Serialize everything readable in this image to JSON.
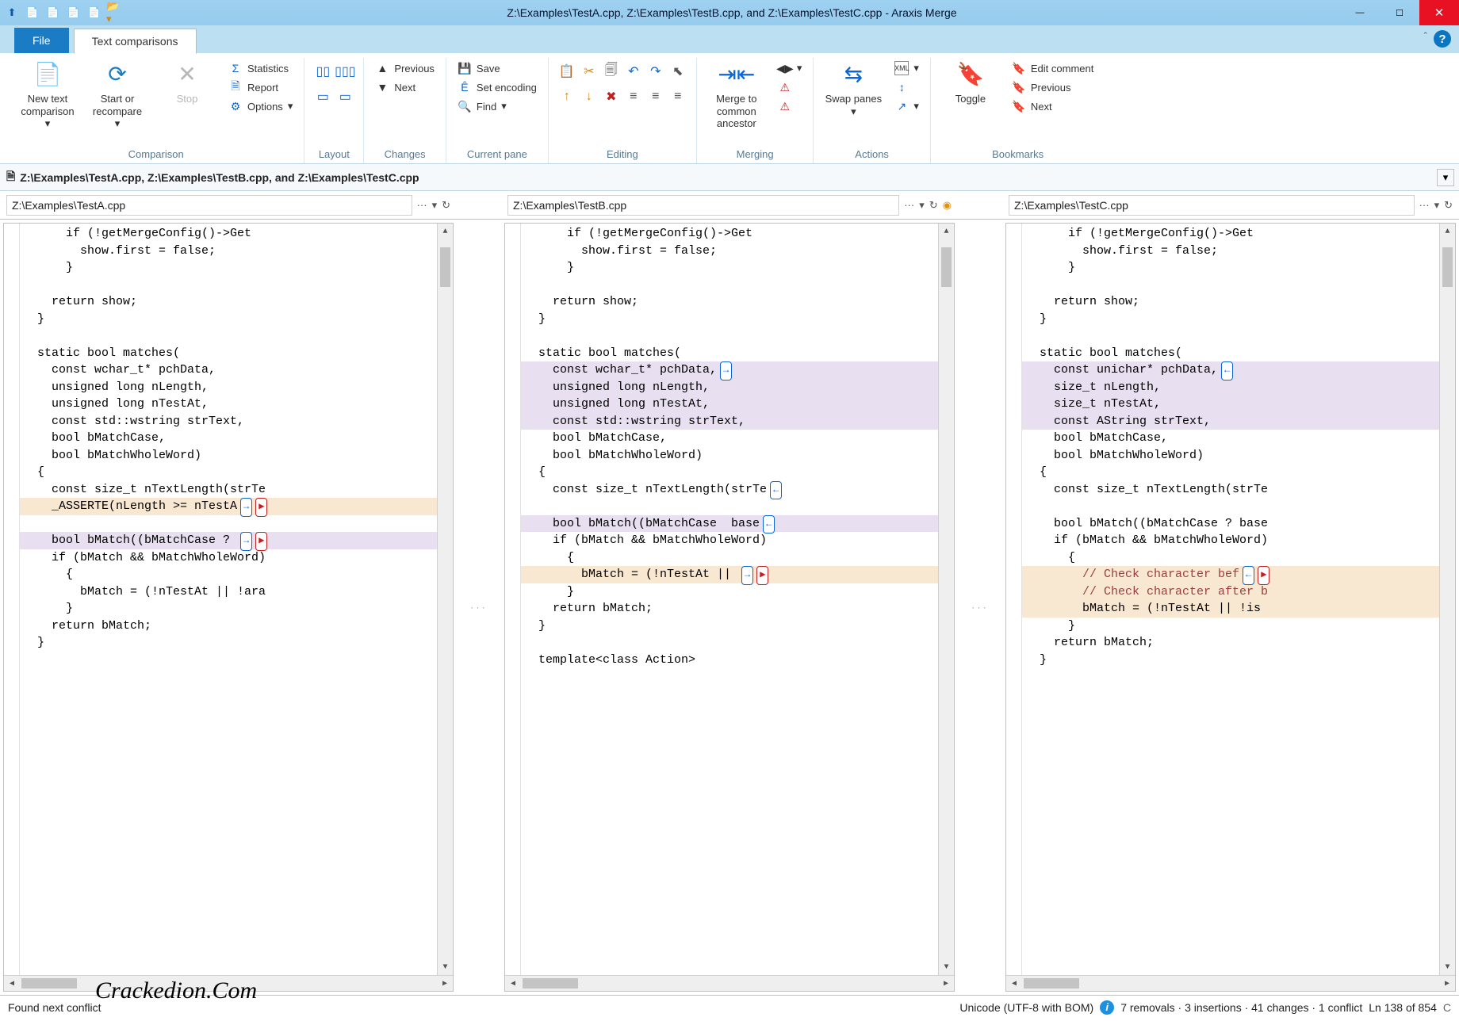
{
  "window": {
    "title": "Z:\\Examples\\TestA.cpp, Z:\\Examples\\TestB.cpp, and Z:\\Examples\\TestC.cpp - Araxis Merge"
  },
  "tabs": {
    "file": "File",
    "active": "Text comparisons"
  },
  "ribbon": {
    "new_text": "New text comparison",
    "start": "Start or recompare",
    "stop": "Stop",
    "statistics": "Statistics",
    "report": "Report",
    "options": "Options",
    "previous": "Previous",
    "next": "Next",
    "save": "Save",
    "set_encoding": "Set encoding",
    "find": "Find",
    "merge_common": "Merge to common ancestor",
    "swap_panes": "Swap panes",
    "toggle": "Toggle",
    "edit_comment": "Edit comment",
    "bm_prev": "Previous",
    "bm_next": "Next",
    "groups": {
      "comparison": "Comparison",
      "layout": "Layout",
      "changes": "Changes",
      "current_pane": "Current pane",
      "editing": "Editing",
      "merging": "Merging",
      "actions": "Actions",
      "bookmarks": "Bookmarks"
    }
  },
  "doctab": "Z:\\Examples\\TestA.cpp, Z:\\Examples\\TestB.cpp, and Z:\\Examples\\TestC.cpp",
  "panes": {
    "a": "Z:\\Examples\\TestA.cpp",
    "b": "Z:\\Examples\\TestB.cpp",
    "c": "Z:\\Examples\\TestC.cpp"
  },
  "code": {
    "a": [
      {
        "t": "      if (!getMergeConfig()->Get"
      },
      {
        "t": "        show.first = false;"
      },
      {
        "t": "      }"
      },
      {
        "t": ""
      },
      {
        "t": "    return show;"
      },
      {
        "t": "  }"
      },
      {
        "t": ""
      },
      {
        "t": "  static bool matches("
      },
      {
        "t": "    const wchar_t* pchData,"
      },
      {
        "t": "    unsigned long nLength,"
      },
      {
        "t": "    unsigned long nTestAt,"
      },
      {
        "t": "    const std::wstring strText,"
      },
      {
        "t": "    bool bMatchCase,"
      },
      {
        "t": "    bool bMatchWholeWord)"
      },
      {
        "t": "  {"
      },
      {
        "t": "    const size_t nTextLength(strTe"
      },
      {
        "t": "    _ASSERTE(nLength >= nTestA",
        "cls": "hl-rem",
        "markers": [
          "→",
          "▶"
        ]
      },
      {
        "t": ""
      },
      {
        "t": "    bool bMatch((bMatchCase ? ",
        "cls": "hl-chg",
        "markers": [
          "→",
          "▶"
        ]
      },
      {
        "t": "    if (bMatch && bMatchWholeWord)"
      },
      {
        "t": "      {"
      },
      {
        "t": "        bMatch = (!nTestAt || !ara"
      },
      {
        "t": "      }"
      },
      {
        "t": "    return bMatch;"
      },
      {
        "t": "  }"
      }
    ],
    "b": [
      {
        "t": "      if (!getMergeConfig()->Get"
      },
      {
        "t": "        show.first = false;"
      },
      {
        "t": "      }"
      },
      {
        "t": ""
      },
      {
        "t": "    return show;"
      },
      {
        "t": "  }"
      },
      {
        "t": ""
      },
      {
        "t": "  static bool matches("
      },
      {
        "t": "    const wchar_t* pchData,",
        "cls": "hl-chg",
        "markers": [
          "→"
        ]
      },
      {
        "t": "    unsigned long nLength,",
        "cls": "hl-chg"
      },
      {
        "t": "    unsigned long nTestAt,",
        "cls": "hl-chg"
      },
      {
        "t": "    const std::wstring strText,",
        "cls": "hl-chg"
      },
      {
        "t": "    bool bMatchCase,"
      },
      {
        "t": "    bool bMatchWholeWord)"
      },
      {
        "t": "  {"
      },
      {
        "t": "    const size_t nTextLength(strTe",
        "markers": [
          "←"
        ]
      },
      {
        "t": ""
      },
      {
        "t": "    bool bMatch((bMatchCase  base",
        "cls": "hl-chg",
        "markers": [
          "←"
        ]
      },
      {
        "t": "    if (bMatch && bMatchWholeWord)"
      },
      {
        "t": "      {"
      },
      {
        "t": "        bMatch = (!nTestAt || ",
        "cls": "hl-rem",
        "markers": [
          "→",
          "▶"
        ]
      },
      {
        "t": "      }"
      },
      {
        "t": "    return bMatch;"
      },
      {
        "t": "  }"
      },
      {
        "t": ""
      },
      {
        "t": "  template<class Action>"
      }
    ],
    "c": [
      {
        "t": "      if (!getMergeConfig()->Get"
      },
      {
        "t": "        show.first = false;"
      },
      {
        "t": "      }"
      },
      {
        "t": ""
      },
      {
        "t": "    return show;"
      },
      {
        "t": "  }"
      },
      {
        "t": ""
      },
      {
        "t": "  static bool matches("
      },
      {
        "t": "    const unichar* pchData,",
        "cls": "hl-chg",
        "markers": [
          "←"
        ]
      },
      {
        "t": "    size_t nLength,",
        "cls": "hl-chg"
      },
      {
        "t": "    size_t nTestAt,",
        "cls": "hl-chg"
      },
      {
        "t": "    const AString strText,",
        "cls": "hl-chg"
      },
      {
        "t": "    bool bMatchCase,"
      },
      {
        "t": "    bool bMatchWholeWord)"
      },
      {
        "t": "  {"
      },
      {
        "t": "    const size_t nTextLength(strTe"
      },
      {
        "t": ""
      },
      {
        "t": "    bool bMatch((bMatchCase ? base"
      },
      {
        "t": "    if (bMatch && bMatchWholeWord)"
      },
      {
        "t": "      {"
      },
      {
        "t": "        // Check character bef",
        "cls": "hl-rem cm",
        "markers": [
          "←",
          "▶"
        ]
      },
      {
        "t": "        // Check character after b",
        "cls": "hl-rem cm"
      },
      {
        "t": "        bMatch = (!nTestAt || !is",
        "cls": "hl-rem"
      },
      {
        "t": "      }"
      },
      {
        "t": "    return bMatch;"
      },
      {
        "t": "  }"
      }
    ]
  },
  "status": {
    "left": "Found next conflict",
    "encoding": "Unicode (UTF-8 with BOM)",
    "summary": "7 removals · 3 insertions · 41 changes · 1 conflict",
    "position": "Ln 138 of 854"
  },
  "watermark": "Crackedion.Com"
}
